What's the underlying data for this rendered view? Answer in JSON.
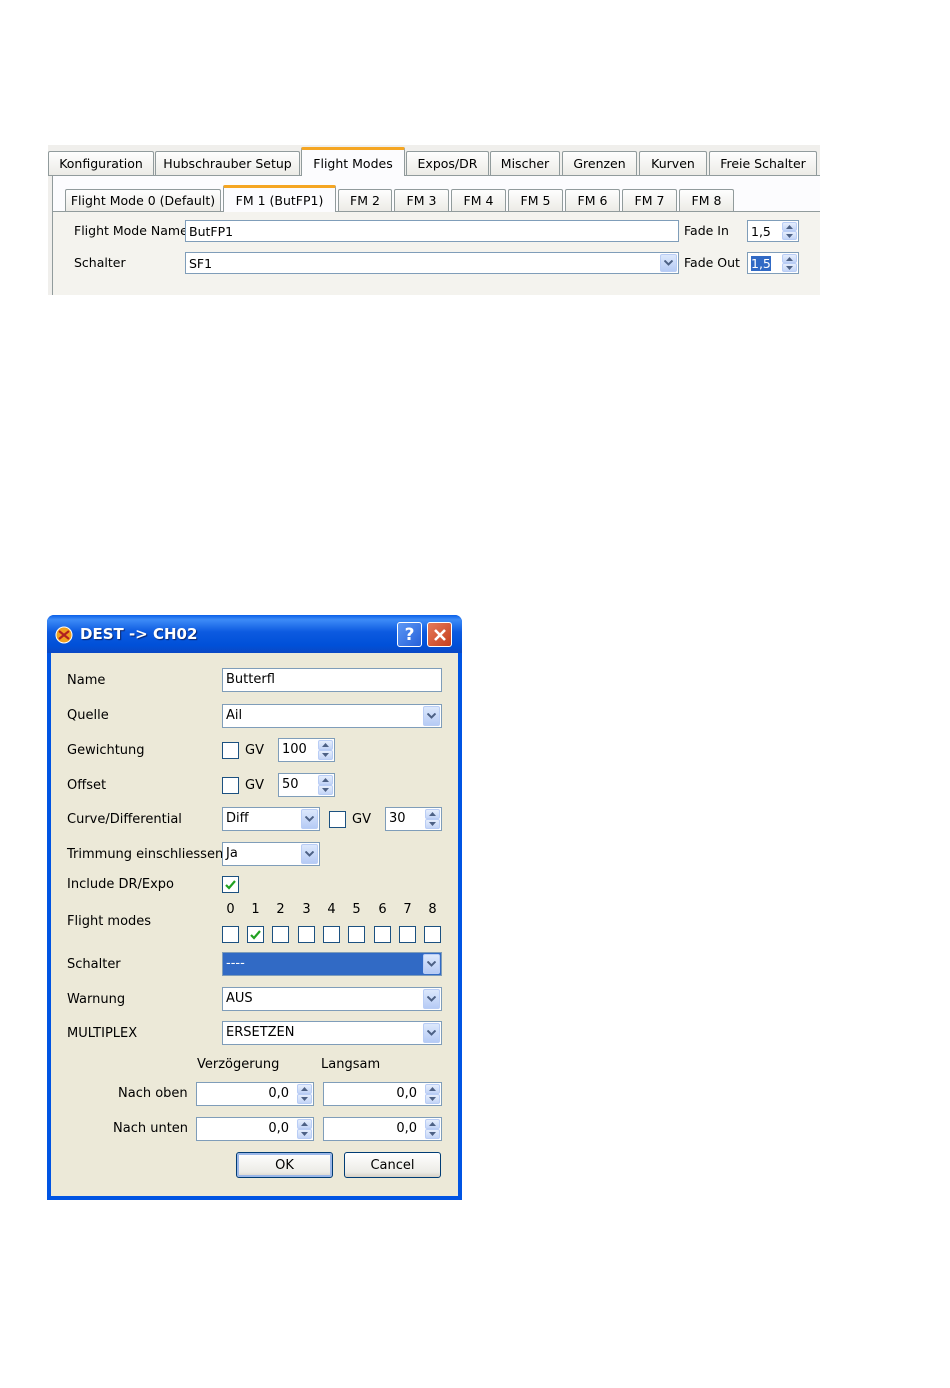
{
  "tabs": {
    "main": [
      "Konfiguration",
      "Hubschrauber Setup",
      "Flight Modes",
      "Expos/DR",
      "Mischer",
      "Grenzen",
      "Kurven",
      "Freie Schalter"
    ],
    "sub": [
      "Flight Mode 0 (Default)",
      "FM 1 (ButFP1)",
      "FM 2",
      "FM 3",
      "FM 4",
      "FM 5",
      "FM 6",
      "FM 7",
      "FM 8"
    ]
  },
  "flight_mode": {
    "name_label": "Flight Mode Name",
    "name_value": "ButFP1",
    "switch_label": "Schalter",
    "switch_value": "SF1",
    "fade_in_label": "Fade In",
    "fade_in_value": "1,5",
    "fade_out_label": "Fade Out",
    "fade_out_value": "1,5"
  },
  "dialog": {
    "title": "DEST -> CH02",
    "help": "?",
    "labels": {
      "name": "Name",
      "quelle": "Quelle",
      "gewichtung": "Gewichtung",
      "offset": "Offset",
      "curve": "Curve/Differential",
      "trim": "Trimmung einschliessen",
      "include": "Include DR/Expo",
      "flight_modes": "Flight modes",
      "schalter": "Schalter",
      "warnung": "Warnung",
      "multiplex": "MULTIPLEX",
      "delay": "Verzögerung",
      "slow": "Langsam",
      "up": "Nach oben",
      "down": "Nach unten"
    },
    "values": {
      "name": "Butterfl",
      "quelle": "Ail",
      "gv": "GV",
      "gewichtung": "100",
      "offset": "50",
      "curve_type": "Diff",
      "curve_value": "30",
      "trim": "Ja",
      "schalter": "----",
      "warnung": "AUS",
      "multiplex": "ERSETZEN",
      "delay_up": "0,0",
      "slow_up": "0,0",
      "delay_down": "0,0",
      "slow_down": "0,0"
    },
    "flight_mode_numbers": [
      "0",
      "1",
      "2",
      "3",
      "4",
      "5",
      "6",
      "7",
      "8"
    ],
    "flight_mode_checked": [
      false,
      true,
      false,
      false,
      false,
      false,
      false,
      false,
      false
    ],
    "include_checked": true,
    "ok": "OK",
    "cancel": "Cancel"
  }
}
